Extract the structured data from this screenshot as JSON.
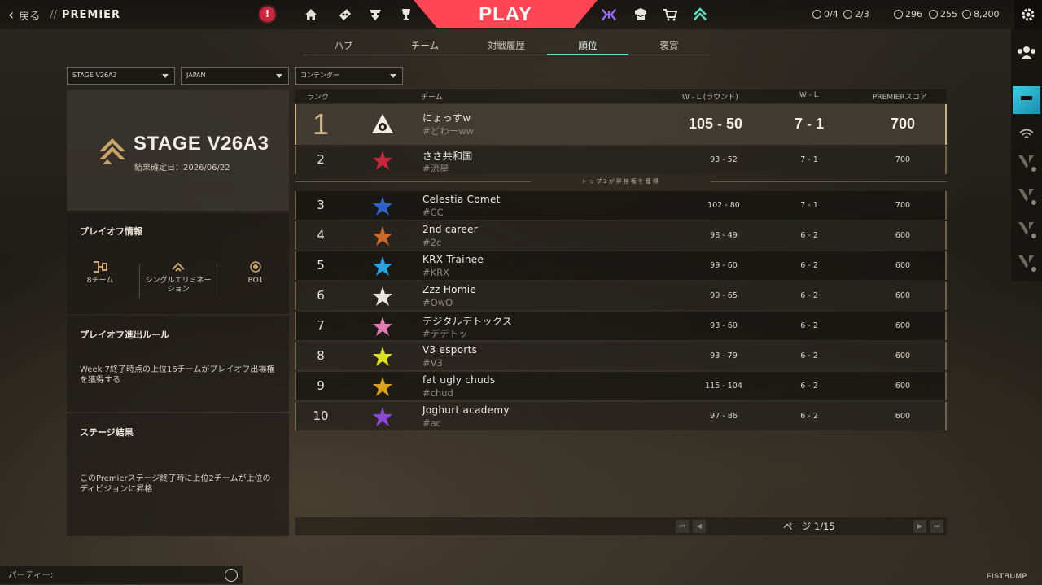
{
  "topbar": {
    "back_label": "戻る",
    "separator": "//",
    "section": "PREMIER",
    "alert_symbol": "!",
    "play_label": "PLAY",
    "nav_icons": [
      "home-icon",
      "career-icon",
      "agents-icon",
      "trophy-icon"
    ],
    "right_icons": [
      "battlepass-icon",
      "collection-icon",
      "store-icon",
      "premier-icon"
    ],
    "progress": [
      {
        "icon": "hex-token-icon",
        "value": "0/4"
      },
      {
        "icon": "plus-token-icon",
        "value": "2/3"
      }
    ],
    "currencies": [
      {
        "icon": "valorant-points-icon",
        "value": "296"
      },
      {
        "icon": "radianite-icon",
        "value": "255"
      },
      {
        "icon": "kingdom-credits-icon",
        "value": "8,200"
      }
    ]
  },
  "tabs": [
    {
      "label": "ハブ",
      "active": false
    },
    {
      "label": "チーム",
      "active": false
    },
    {
      "label": "対戦履歴",
      "active": false
    },
    {
      "label": "順位",
      "active": true
    },
    {
      "label": "褒賞",
      "active": false
    }
  ],
  "filters": [
    {
      "value": "STAGE V26A3"
    },
    {
      "value": "JAPAN"
    },
    {
      "value": "コンテンダー"
    }
  ],
  "stage": {
    "title": "STAGE V26A3",
    "date_label": "結果確定日：2026/06/22"
  },
  "playoff_info": {
    "heading": "プレイオフ情報",
    "items": [
      {
        "icon": "bracket-icon",
        "label": "8チーム"
      },
      {
        "icon": "single-elimination-icon",
        "label": "シングルエリミネーション"
      },
      {
        "icon": "bo1-icon",
        "label": "BO1"
      }
    ]
  },
  "playoff_rule": {
    "heading": "プレイオフ進出ルール",
    "text": "Week 7終了時点の上位16チームがプレイオフ出場権を獲得する"
  },
  "stage_result": {
    "heading": "ステージ結果",
    "text": "このPremierステージ終了時に上位2チームが上位のディビジョンに昇格"
  },
  "table": {
    "headers": {
      "rank": "ランク",
      "team": "チーム",
      "wl_rounds": "W - L (ラウンド)",
      "wl": "W - L",
      "score": "PREMIERスコア"
    },
    "promotion_label": "トップ2が昇格権を獲得",
    "rows": [
      {
        "rank": "1",
        "name": "にょっすw",
        "tag": "#どわーww",
        "rounds": "105 - 50",
        "wl": "7 - 1",
        "score": "700",
        "logo": "triangle-eye-logo"
      },
      {
        "rank": "2",
        "name": "ささ共和国",
        "tag": "#流星",
        "rounds": "93 - 52",
        "wl": "7 - 1",
        "score": "700",
        "logo": "red-dragon-logo"
      },
      {
        "rank": "3",
        "name": "Celestia Comet",
        "tag": "#CC",
        "rounds": "102 - 80",
        "wl": "7 - 1",
        "score": "700",
        "logo": "blue-star-logo"
      },
      {
        "rank": "4",
        "name": "2nd career",
        "tag": "#2c",
        "rounds": "98 - 49",
        "wl": "6 - 2",
        "score": "600",
        "logo": "bear-logo"
      },
      {
        "rank": "5",
        "name": "KRX Trainee",
        "tag": "#KRX",
        "rounds": "99 - 60",
        "wl": "6 - 2",
        "score": "600",
        "logo": "crosshair-logo"
      },
      {
        "rank": "6",
        "name": "Zzz Homie",
        "tag": "#OwO",
        "rounds": "99 - 65",
        "wl": "6 - 2",
        "score": "600",
        "logo": "skull-logo"
      },
      {
        "rank": "7",
        "name": "デジタルデトックス",
        "tag": "#デデトッ",
        "rounds": "93 - 60",
        "wl": "6 - 2",
        "score": "600",
        "logo": "lotus-logo"
      },
      {
        "rank": "8",
        "name": "V3 esports",
        "tag": "#V3",
        "rounds": "93 - 79",
        "wl": "6 - 2",
        "score": "600",
        "logo": "yellow-v-logo"
      },
      {
        "rank": "9",
        "name": "fat ugly chuds",
        "tag": "#chud",
        "rounds": "115 - 104",
        "wl": "6 - 2",
        "score": "600",
        "logo": "chud-logo"
      },
      {
        "rank": "10",
        "name": "Joghurt academy",
        "tag": "#ac",
        "rounds": "97 - 86",
        "wl": "6 - 2",
        "score": "600",
        "logo": "purple-dragon-logo"
      }
    ]
  },
  "pager": {
    "label": "ページ 1/15",
    "first": "⏮",
    "prev": "◀",
    "next": "▶",
    "last": "⏭"
  },
  "rail": {
    "icons": [
      "social-icon",
      "player-avatar",
      "wifi-icon",
      "friend-icon",
      "friend-icon",
      "friend-icon",
      "friend-icon"
    ]
  },
  "party": {
    "label": "パーティー:"
  },
  "brand": "FISTBUMP",
  "colors": {
    "play": "#ff4655",
    "accent": "#5be0c0",
    "gold": "#c8b078",
    "alert": "#c8283c"
  }
}
